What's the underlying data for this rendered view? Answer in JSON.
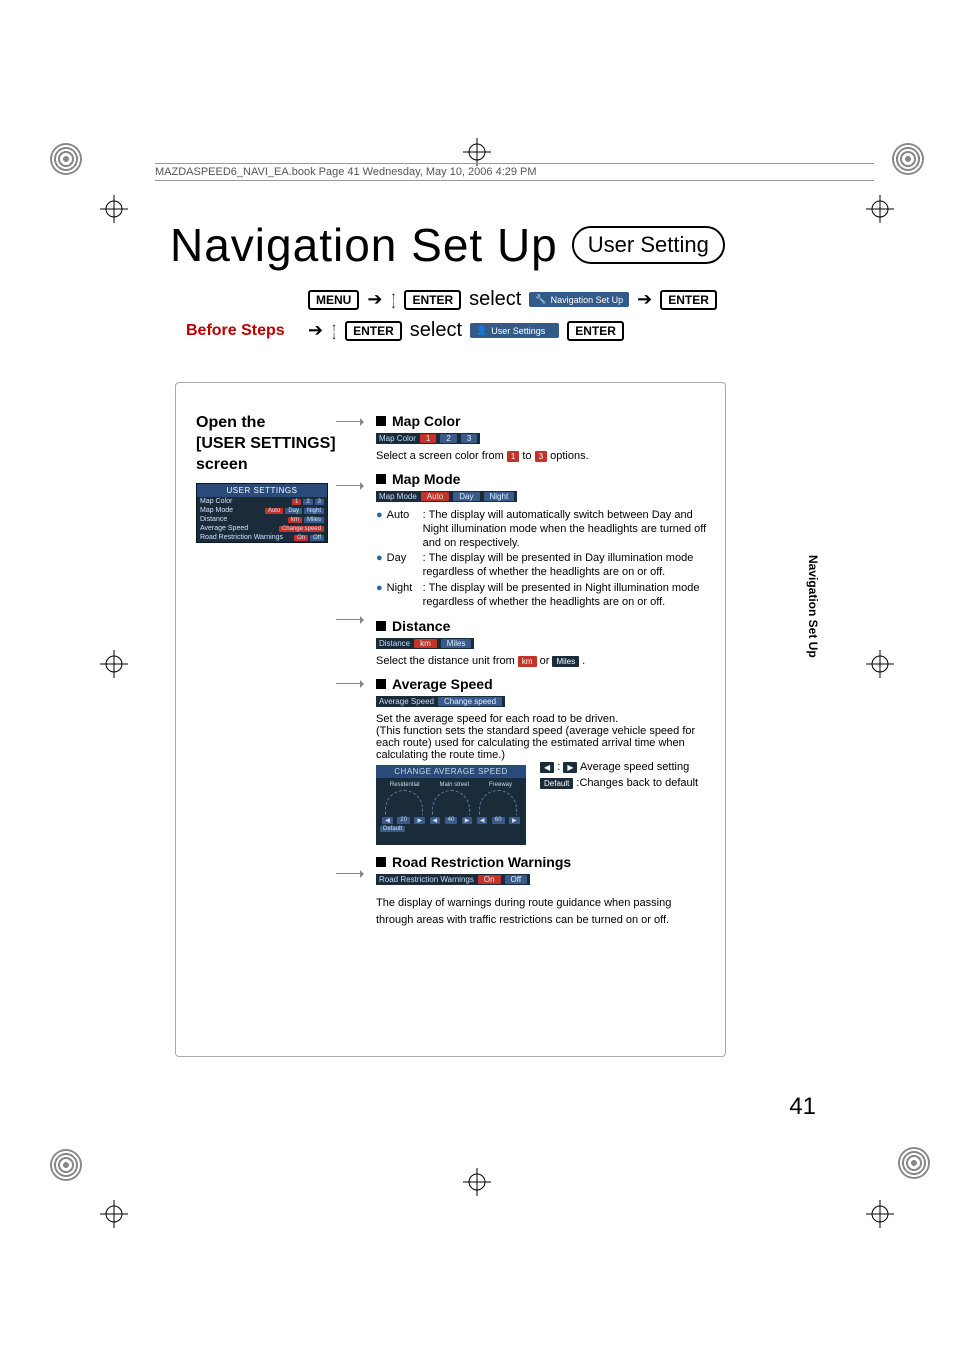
{
  "running_header": "MAZDASPEED6_NAVI_EA.book  Page 41  Wednesday, May 10, 2006  4:29 PM",
  "title": "Navigation Set Up",
  "subtitle_oval": "User Setting",
  "side_tab": "Navigation Set Up",
  "page_number": "41",
  "before": {
    "label": "Before Steps",
    "menu_key": "MENU",
    "enter_key": "ENTER",
    "select_word": "select",
    "nav_setup_chip": "Navigation Set Up",
    "user_settings_chip": "User Settings"
  },
  "open_heading_l1": "Open the",
  "open_heading_l2": "[USER SETTINGS]",
  "open_heading_l3": "screen",
  "user_settings_panel": {
    "title": "USER SETTINGS",
    "rows": [
      {
        "label": "Map Color",
        "opts": [
          "1",
          "2",
          "3"
        ],
        "sel": 0
      },
      {
        "label": "Map Mode",
        "opts": [
          "Auto",
          "Day",
          "Night"
        ],
        "sel": 0
      },
      {
        "label": "Distance",
        "opts": [
          "km",
          "Miles"
        ],
        "sel": 0
      },
      {
        "label": "Average Speed",
        "opts": [
          "Change speed"
        ],
        "sel": 0
      },
      {
        "label": "Road Restriction Warnings",
        "opts": [
          "On",
          "Off"
        ],
        "sel": 0
      }
    ]
  },
  "sections": {
    "map_color": {
      "heading": "Map Color",
      "bar_label": "Map Color",
      "bar_opts": [
        "1",
        "2",
        "3"
      ],
      "note_pre": "Select a screen color from ",
      "note_mid": " to ",
      "note_post": " options.",
      "chip_from": "1",
      "chip_to": "3"
    },
    "map_mode": {
      "heading": "Map Mode",
      "bar_label": "Map Mode",
      "bar_opts": [
        "Auto",
        "Day",
        "Night"
      ],
      "items": [
        {
          "name": "Auto",
          "desc": ": The display will automatically switch between Day and Night illumination mode when the headlights are turned off and on respectively."
        },
        {
          "name": "Day",
          "desc": ": The display will be presented in Day illumination mode regardless of whether the headlights are on or off."
        },
        {
          "name": "Night",
          "desc": ": The display will be presented in Night illumination mode regardless of whether the headlights are on or off."
        }
      ]
    },
    "distance": {
      "heading": "Distance",
      "bar_label": "Distance",
      "bar_opts": [
        "km",
        "Miles"
      ],
      "note_pre": "Select the distance unit from ",
      "note_mid": " or ",
      "note_post": ".",
      "chip_a": "km",
      "chip_b": "Miles"
    },
    "avg_speed": {
      "heading": "Average Speed",
      "bar_label": "Average Speed",
      "bar_opts": [
        "Change speed"
      ],
      "note": "Set the average speed for each road to be driven.\n(This function sets the standard speed (average vehicle speed for each route) used for calculating the estimated arrival time when calculating the route time.)",
      "img_title": "CHANGE AVERAGE SPEED",
      "img_cols": [
        "Residential",
        "Main street",
        "Freeway"
      ],
      "img_vals": [
        "20",
        "40",
        "60"
      ],
      "default_btn": "Default",
      "legend_arrows": "Average speed setting",
      "legend_default": ":Changes back to default"
    },
    "road_restrict": {
      "heading": "Road Restriction Warnings",
      "bar_label": "Road Restriction Warnings",
      "bar_opts": [
        "On",
        "Off"
      ],
      "note": "The display of warnings during route guidance when passing through areas with traffic restrictions can be turned on or off."
    }
  }
}
